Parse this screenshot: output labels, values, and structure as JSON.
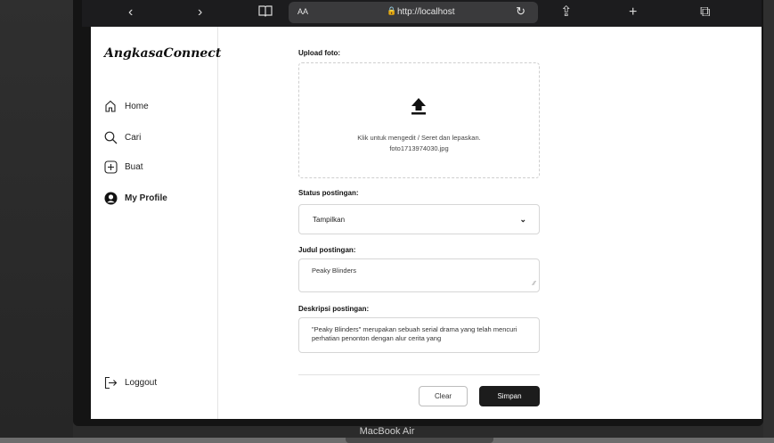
{
  "browser": {
    "back": "‹",
    "forward": "›",
    "text_size": "AA",
    "url": "http://localhost",
    "reload": "↻",
    "share": "⇪",
    "new_tab": "+",
    "tabs": "⧉"
  },
  "sidebar": {
    "brand": "AngkasaConnect",
    "items": [
      {
        "label": "Home",
        "icon": "home-icon"
      },
      {
        "label": "Cari",
        "icon": "search-icon"
      },
      {
        "label": "Buat",
        "icon": "plus-square-icon"
      },
      {
        "label": "My Profile",
        "icon": "profile-icon"
      }
    ],
    "logout": {
      "label": "Loggout",
      "icon": "logout-icon"
    }
  },
  "form": {
    "upload_label": "Upload foto:",
    "upload_hint": "Klik untuk mengedit / Seret dan lepaskan.",
    "upload_filename": "foto1713974030.jpg",
    "status_label": "Status postingan:",
    "status_value": "Tampilkan",
    "title_label": "Judul postingan:",
    "title_value": "Peaky Blinders",
    "desc_label": "Deskripsi postingan:",
    "desc_value": "\"Peaky Blinders\" merupakan sebuah serial drama yang telah mencuri perhatian penonton dengan alur cerita yang",
    "clear_label": "Clear",
    "save_label": "Simpan"
  },
  "device": {
    "label": "MacBook Air"
  },
  "colors": {
    "primary_button": "#1c1c1c",
    "page_bg": "#ffffff",
    "toolbar_bg": "#1c1c1e"
  }
}
